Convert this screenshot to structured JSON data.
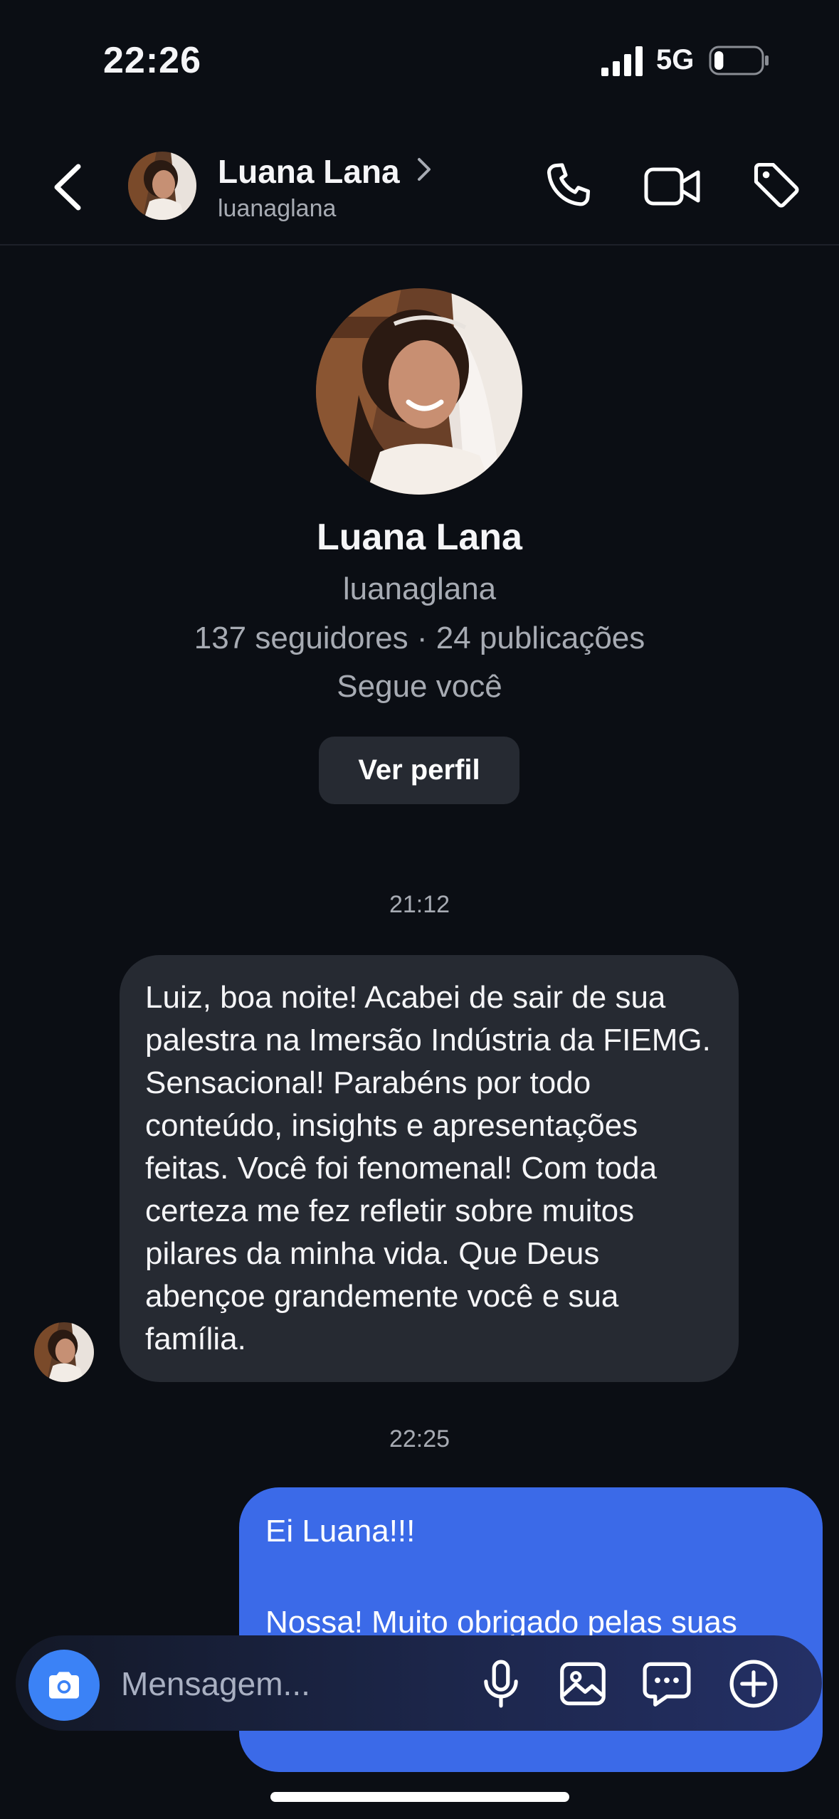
{
  "status_bar": {
    "time": "22:26",
    "network": "5G",
    "signal_bars": 4,
    "battery_level": 0.2
  },
  "header": {
    "name": "Luana Lana",
    "username": "luanaglana",
    "icons": [
      "back-arrow-icon",
      "chevron-right-icon",
      "phone-icon",
      "video-camera-icon",
      "tag-icon"
    ]
  },
  "profile": {
    "name": "Luana Lana",
    "username": "luanaglana",
    "stats": "137 seguidores · 24 publicações",
    "follows_you": "Segue você",
    "view_profile_label": "Ver perfil"
  },
  "messages": [
    {
      "timestamp": "21:12",
      "direction": "incoming",
      "text": "Luiz, boa noite! Acabei de sair de sua palestra na Imersão Indústria da FIEMG. Sensacional! Parabéns por todo conteúdo, insights e apresentações feitas. Você foi fenomenal! Com toda certeza me fez refletir sobre muitos pilares da minha vida. Que Deus abençoe grandemente você e sua família."
    },
    {
      "timestamp": "22:25",
      "direction": "outgoing",
      "line1": "Ei Luana!!!",
      "line2": "Nossa! Muito obrigado pelas suas"
    }
  ],
  "composer": {
    "placeholder": "Mensagem...",
    "icons": [
      "camera-icon",
      "microphone-icon",
      "gallery-icon",
      "sticker-icon",
      "plus-icon"
    ]
  },
  "colors": {
    "background": "#0b0e14",
    "incoming_bubble": "#262a32",
    "outgoing_bubble": "#3b6ae8",
    "camera_button": "#3b82f6",
    "secondary_text": "#a7abb3"
  }
}
